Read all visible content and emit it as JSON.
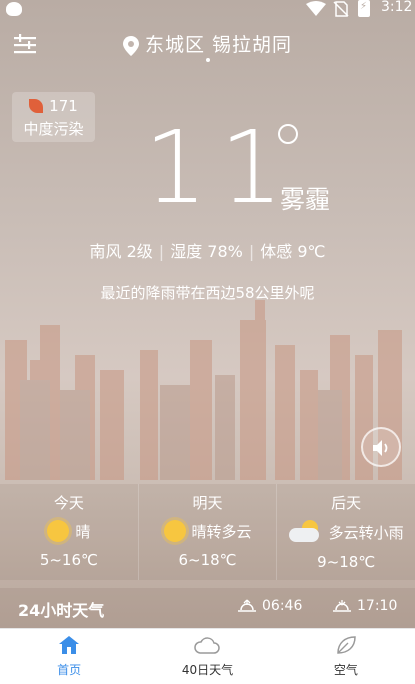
{
  "status_bar": {
    "time": "3:12"
  },
  "header": {
    "location": "东城区 锡拉胡同"
  },
  "aqi": {
    "value": "171",
    "label": "中度污染"
  },
  "current": {
    "temperature": "11",
    "condition": "雾霾",
    "wind": "南风 2级",
    "humidity": "湿度 78%",
    "feels_like": "体感 9℃",
    "rain_message": "最近的降雨带在西边58公里外呢"
  },
  "forecast": [
    {
      "day": "今天",
      "condition": "晴",
      "icon": "sun-icon",
      "range": "5~16℃"
    },
    {
      "day": "明天",
      "condition": "晴转多云",
      "icon": "sun-icon",
      "range": "6~18℃"
    },
    {
      "day": "后天",
      "condition": "多云转小雨",
      "icon": "cloud-sun-icon",
      "range": "9~18℃"
    }
  ],
  "hourly": {
    "title": "24小时天气",
    "sunrise": "06:46",
    "sunset": "17:10"
  },
  "tabs": [
    {
      "label": "首页",
      "icon": "home-icon",
      "active": true
    },
    {
      "label": "40日天气",
      "icon": "cloud-icon",
      "active": false
    },
    {
      "label": "空气",
      "icon": "leaf-icon",
      "active": false
    }
  ],
  "colors": {
    "accent": "#3b8ee8",
    "aqi_leaf": "#e0603a",
    "sun": "#f7c640"
  }
}
